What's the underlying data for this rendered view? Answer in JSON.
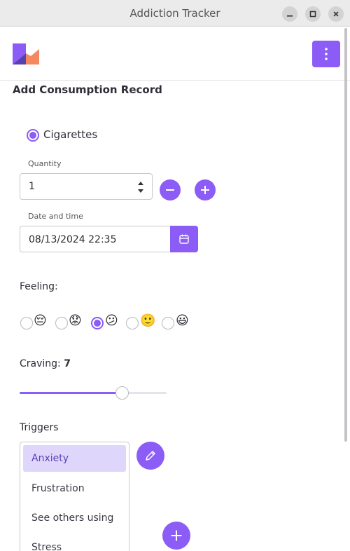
{
  "window": {
    "title": "Addiction Tracker"
  },
  "header": {
    "logo_colors": [
      "#8b5cf6",
      "#f4895f"
    ],
    "menu_icon": "kebab-menu-icon"
  },
  "page": {
    "title": "Add Consumption Record"
  },
  "substance": {
    "label": "Cigarettes",
    "selected": true
  },
  "quantity": {
    "label": "Quantity",
    "value": "1"
  },
  "datetime": {
    "label": "Date and time",
    "value": "08/13/2024 22:35"
  },
  "feeling": {
    "label": "Feeling:",
    "options": [
      "😔",
      "😟",
      "😕",
      "🙂",
      "😃"
    ],
    "selected_index": 2
  },
  "craving": {
    "label": "Craving:",
    "value": "7",
    "level": 0.7
  },
  "triggers": {
    "label": "Triggers",
    "items": [
      "Anxiety",
      "Frustration",
      "See others using",
      "Stress"
    ],
    "selected_index": 0
  },
  "colors": {
    "accent": "#8b5cf6",
    "accent_light": "#ded7fb"
  }
}
